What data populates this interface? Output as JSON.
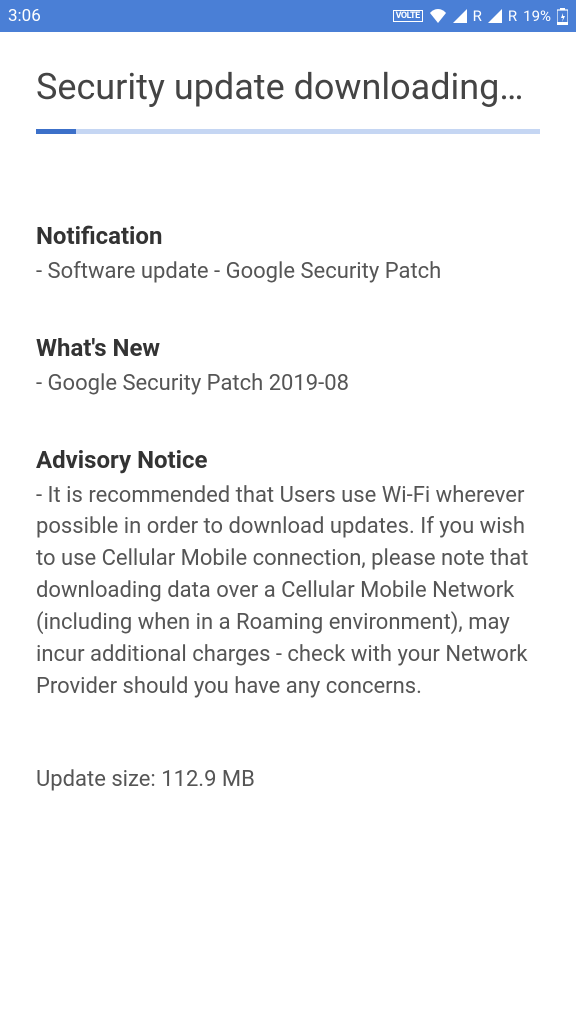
{
  "status_bar": {
    "time": "3:06",
    "roaming_label": "R",
    "battery_percent": "19%"
  },
  "page": {
    "title": "Security update downloading…",
    "progress_percent": 8
  },
  "sections": {
    "notification": {
      "heading": "Notification",
      "body": "- Software update - Google Security Patch"
    },
    "whats_new": {
      "heading": "What's New",
      "body": "- Google Security Patch 2019-08"
    },
    "advisory": {
      "heading": "Advisory Notice",
      "body": "- It is recommended that Users use Wi-Fi wherever possible in order to download updates. If you wish to use Cellular Mobile connection, please note that downloading data over a Cellular Mobile Network (including when in a Roaming environment), may incur additional charges - check with your Network Provider should you have any concerns."
    }
  },
  "update_size": "Update size: 112.9 MB"
}
